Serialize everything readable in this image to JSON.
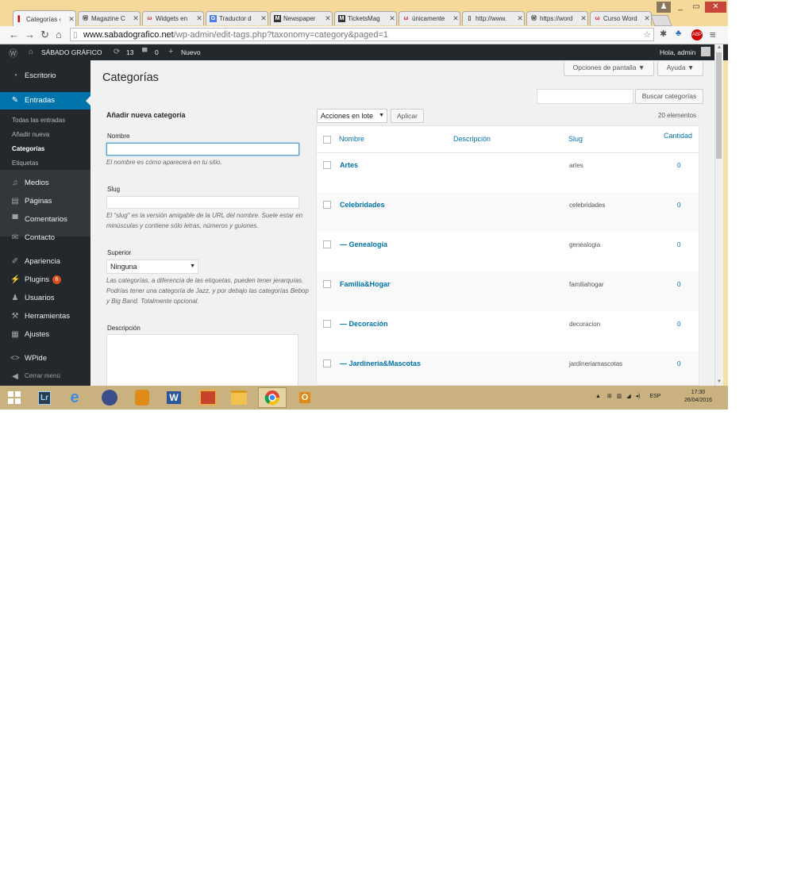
{
  "browser": {
    "tabs": [
      {
        "label": "Categorías ‹",
        "favicon": "wp-admin-favicon"
      },
      {
        "label": "Magazine C",
        "favicon": "wordpress-logo"
      },
      {
        "label": "Widgets en",
        "favicon": "w-red-logo"
      },
      {
        "label": "Traductor d",
        "favicon": "translate-icon"
      },
      {
        "label": "Newspaper",
        "favicon": "m-logo"
      },
      {
        "label": "TicketsMag",
        "favicon": "m-logo"
      },
      {
        "label": "únicamente",
        "favicon": "w-red-logo"
      },
      {
        "label": "http://www.",
        "favicon": "page-icon"
      },
      {
        "label": "https://word",
        "favicon": "wordpress-logo"
      },
      {
        "label": "Curso Word",
        "favicon": "w-red-logo"
      }
    ],
    "url_host": "www.sabadografico.net",
    "url_path": "/wp-admin/edit-tags.php?taxonomy=category&paged=1"
  },
  "adminbar": {
    "site_name": "SÁBADO GRÁFICO",
    "updates": "13",
    "comments": "0",
    "new_label": "Nuevo",
    "greeting": "Hola, admin"
  },
  "sidebar": {
    "dashboard": "Escritorio",
    "posts": "Entradas",
    "sub": [
      "Todas las entradas",
      "Añadir nueva",
      "Categorías",
      "Etiquetas"
    ],
    "media": "Medios",
    "pages": "Páginas",
    "comments": "Comentarios",
    "contact": "Contacto",
    "appearance": "Apariencia",
    "plugins": "Plugins",
    "plugins_badge": "6",
    "users": "Usuarios",
    "tools": "Herramientas",
    "settings": "Ajustes",
    "wpide": "WPide",
    "collapse": "Cerrar menú"
  },
  "page": {
    "title": "Categorías",
    "screen_options": "Opciones de pantalla ▼",
    "help": "Ayuda ▼",
    "search_button": "Buscar categorías"
  },
  "form": {
    "heading": "Añadir nueva categoría",
    "name_label": "Nombre",
    "name_help": "El nombre es cómo aparecerá en tu sitio.",
    "slug_label": "Slug",
    "slug_help": "El “slug” es la versión amigable de la URL del nombre. Suele estar en minúsculas y contiene sólo letras, números y guiones.",
    "parent_label": "Superior",
    "parent_value": "Ninguna",
    "parent_help": "Las categorías, a diferencia de las etiquetas, pueden tener jerarquías. Podrías tener una categoría de Jazz, y por debajo las categorías Bebop y Big Band. Totalmente opcional.",
    "description_label": "Descripción"
  },
  "list": {
    "bulk_actions": "Acciones en lote",
    "apply": "Aplicar",
    "count": "20 elementos",
    "columns": {
      "name": "Nombre",
      "description": "Descripción",
      "slug": "Slug",
      "count": "Cantidad"
    },
    "rows": [
      {
        "name": "Artes",
        "slug": "artes",
        "count": "0"
      },
      {
        "name": "Celebridades",
        "slug": "celebridades",
        "count": "0"
      },
      {
        "name": "— Genealogía",
        "slug": "genealogia",
        "count": "0"
      },
      {
        "name": "Familia&Hogar",
        "slug": "familiahogar",
        "count": "0"
      },
      {
        "name": "— Decoración",
        "slug": "decoracion",
        "count": "0"
      },
      {
        "name": "— Jardinería&Mascotas",
        "slug": "jardineriamascotas",
        "count": "0"
      }
    ]
  },
  "taskbar": {
    "apps": [
      "start-button",
      "lightroom",
      "internet-explorer",
      "app-circle",
      "app-orange",
      "word",
      "app-red",
      "file-explorer",
      "chrome",
      "outlook"
    ],
    "lang": "ESP",
    "time": "17:30",
    "date": "26/04/2016"
  },
  "colors": {
    "wp_dark": "#23282d",
    "wp_blue": "#0073aa",
    "accent_menu": "#0073aa",
    "taskbar": "#c9b27f",
    "badge": "#d54e21"
  }
}
